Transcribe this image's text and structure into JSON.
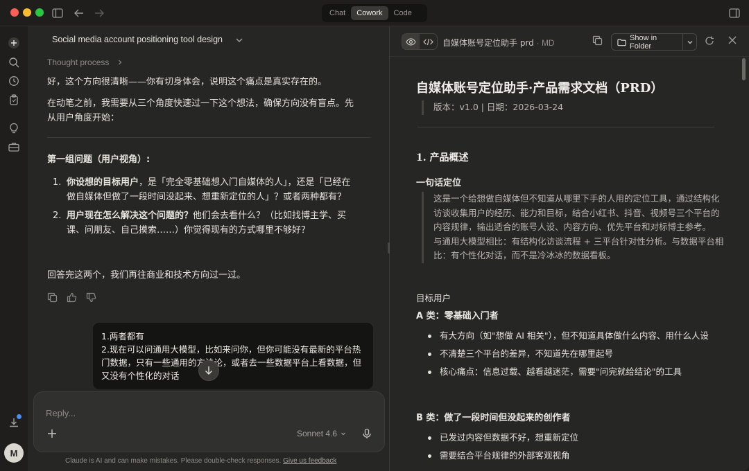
{
  "titlebar": {
    "modes": [
      {
        "label": "Chat",
        "active": false
      },
      {
        "label": "Cowork",
        "active": true
      },
      {
        "label": "Code",
        "active": false
      }
    ]
  },
  "rail": {
    "avatar_initial": "M",
    "icons": [
      "plus-icon",
      "search-icon",
      "clock-icon",
      "clipboard-icon",
      "lightbulb-icon",
      "briefcase-icon",
      "download-icon"
    ]
  },
  "chat": {
    "title": "Social media account positioning tool design",
    "thought_label": "Thought process",
    "intro": "好，这个方向很清晰——你有切身体会，说明这个痛点是真实存在的。",
    "pre_questions": "在动笔之前，我需要从三个角度快速过一下这个想法，确保方向没有盲点。先从用户角度开始：",
    "group_heading": "第一组问题（用户视角）:",
    "questions": [
      {
        "num": "1.",
        "bold": "你设想的目标用户",
        "rest": "，是「完全零基础想入门自媒体的人」，还是「已经在做自媒体但做了一段时间没起来、想重新定位的人」？或者两种都有？"
      },
      {
        "num": "2.",
        "bold": "用户现在怎么解决这个问题的？",
        "rest": "他们会去看什么？（比如找博主学、买课、问朋友、自己摸索……）你觉得现有的方式哪里不够好？"
      }
    ],
    "closing": "回答完这两个，我们再往商业和技术方向过一过。",
    "user_bubble_lines": [
      "1.两者都有",
      "2.现在可以问通用大模型，比如来问你，但你可能没有最新的平台热门数据，只有一些通用的方法论，或者去一些数据平台上看数据，但又没有个性化的对话"
    ],
    "composer": {
      "placeholder": "Reply...",
      "model": "Sonnet 4.6"
    },
    "disclaimer": "Claude is AI and can make mistakes. Please double-check responses.",
    "feedback_link": "Give us feedback"
  },
  "doc": {
    "file_name": "自媒体账号定位助手 prd",
    "file_ext": "· MD",
    "show_in_folder": "Show in Folder",
    "title": "自媒体账号定位助手·产品需求文档（PRD）",
    "meta": "版本：v1.0 | 日期：2026-03-24",
    "section1": "1. 产品概述",
    "one_liner_heading": "一句话定位",
    "one_liner_p1": "这是一个给想做自媒体但不知道从哪里下手的人用的定位工具，通过结构化访谈收集用户的经历、能力和目标，结合小红书、抖音、视频号三个平台的内容规律，输出适合的账号人设、内容方向、优先平台和对标博主参考。",
    "one_liner_p2": "与通用大模型相比：有结构化访谈流程 + 三平台针对性分析。与数据平台相比：有个性化对话，而不是冷冰冰的数据看板。",
    "target_users": "目标用户",
    "group_a": "A 类：零基础入门者",
    "group_a_items": [
      "有大方向（如\"想做 AI 相关\"），但不知道具体做什么内容、用什么人设",
      "不清楚三个平台的差异，不知道先在哪里起号",
      "核心痛点：信息过载、越看越迷茫，需要\"问完就给结论\"的工具"
    ],
    "group_b": "B 类：做了一段时间但没起来的创作者",
    "group_b_items": [
      "已发过内容但数据不好，想重新定位",
      "需要结合平台规律的外部客观视角"
    ]
  },
  "colors": {
    "window_bg": "#262624",
    "bubble_bg": "#141413",
    "accent_dot": "#4c8df6"
  }
}
